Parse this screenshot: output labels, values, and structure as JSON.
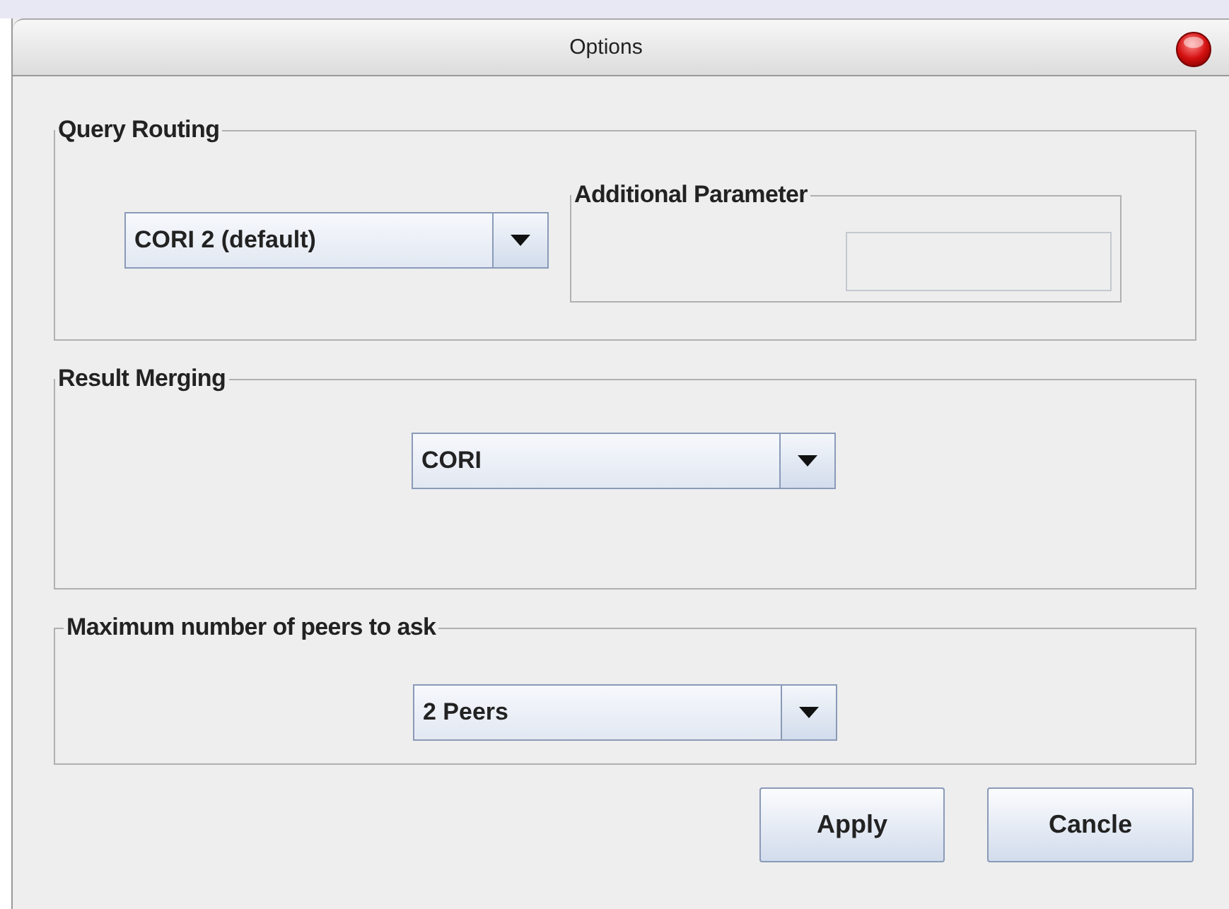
{
  "window": {
    "title": "Options"
  },
  "query_routing": {
    "title": "Query Routing",
    "dropdown": {
      "value": "CORI 2 (default)"
    },
    "additional_parameter": {
      "title": "Additional Parameter",
      "field": {
        "disabled": true
      }
    }
  },
  "result_merging": {
    "title": "Result Merging",
    "dropdown": {
      "value": "CORI"
    }
  },
  "max_peers": {
    "title": "Maximum number of peers to ask",
    "dropdown": {
      "value": "2 Peers"
    }
  },
  "buttons": [
    {
      "label": "Apply"
    },
    {
      "label": "Cancle"
    }
  ]
}
